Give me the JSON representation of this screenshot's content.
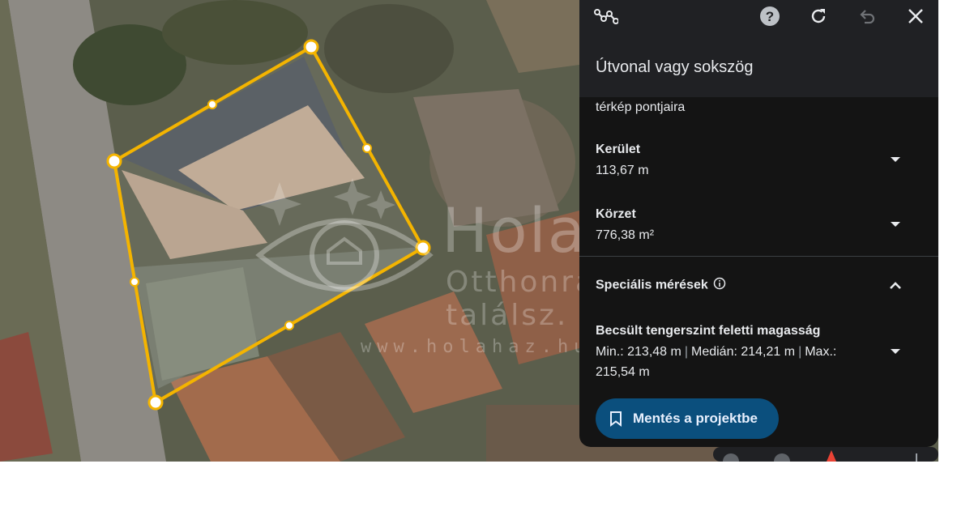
{
  "panel": {
    "title": "Útvonal vagy sokszög",
    "intro_text": "térkép pontjaira",
    "perimeter": {
      "label": "Kerület",
      "value": "113,67 m"
    },
    "area": {
      "label": "Körzet",
      "value": "776,38 m²"
    },
    "special": {
      "label": "Speciális mérések"
    },
    "elevation": {
      "label": "Becsült tengerszint feletti magasság",
      "min": "Min.: 213,48 m",
      "median": "Medián: 214,21 m",
      "max_line1": "Max.:",
      "max_line2": "215,54 m",
      "separator": "|"
    },
    "save_button": "Mentés a projektbe",
    "icons": {
      "path": "path-polygon-icon",
      "help": "help-icon",
      "refresh": "refresh-icon",
      "undo": "undo-icon",
      "close": "close-icon"
    }
  },
  "watermark": {
    "title": "Holaház",
    "subtitle": "Otthonra találsz.",
    "url": "www.holahaz.hu"
  },
  "colors": {
    "polygon": "#f4b400",
    "panel_bg": "#141414",
    "header_bg": "#202124",
    "button_bg": "#0b4f7d"
  }
}
